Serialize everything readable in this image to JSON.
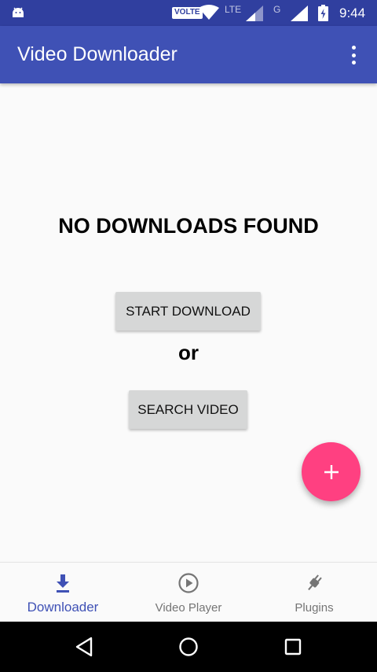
{
  "status_bar": {
    "volte": "VOLTE",
    "network1": "LTE",
    "network2": "G",
    "time": "9:44"
  },
  "app_bar": {
    "title": "Video Downloader"
  },
  "main": {
    "empty_title": "NO DOWNLOADS FOUND",
    "start_button": "START DOWNLOAD",
    "or_text": "or",
    "search_button": "SEARCH VIDEO"
  },
  "fab": {
    "icon": "plus-icon"
  },
  "bottom_nav": {
    "items": [
      {
        "label": "Downloader",
        "icon": "download-icon",
        "active": true
      },
      {
        "label": "Video Player",
        "icon": "play-circle-icon",
        "active": false
      },
      {
        "label": "Plugins",
        "icon": "plug-icon",
        "active": false
      }
    ]
  },
  "colors": {
    "primary_dark": "#303f9f",
    "primary": "#3f51b5",
    "accent": "#ff4081"
  }
}
